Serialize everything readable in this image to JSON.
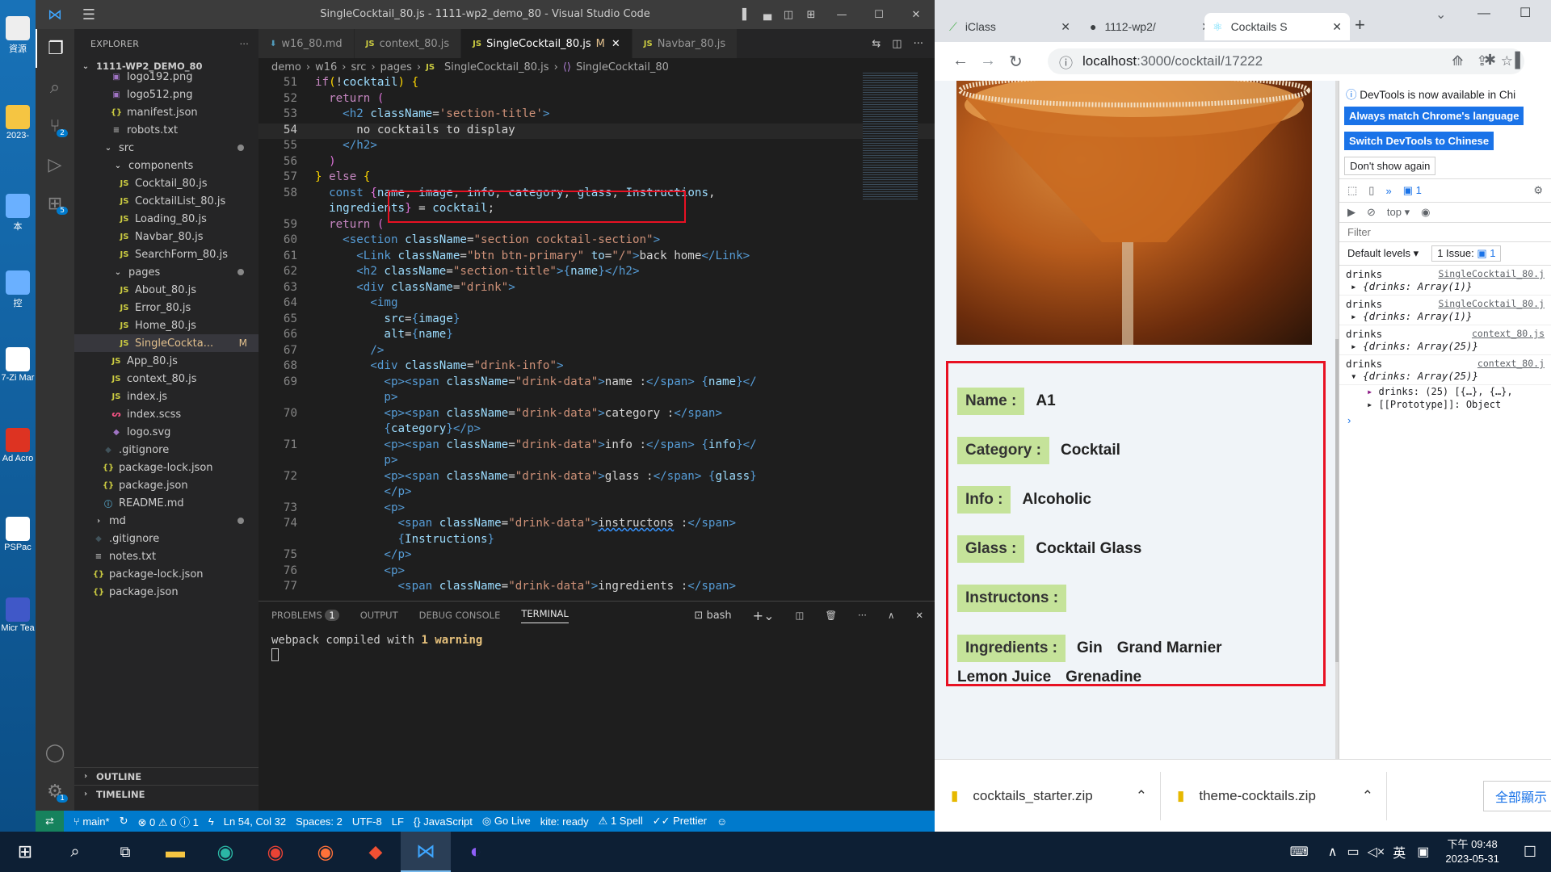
{
  "desktop": {
    "icons": [
      {
        "label": "資源"
      },
      {
        "label": "2023-"
      },
      {
        "label": "本"
      },
      {
        "label": "控"
      },
      {
        "label": "7-Zi Mar"
      },
      {
        "label": "Ad Acro"
      },
      {
        "label": "PSPac"
      },
      {
        "label": "Micr Tea"
      }
    ]
  },
  "vscode": {
    "title": "SingleCocktail_80.js - 1111-wp2_demo_80 - Visual Studio Code",
    "explorer_title": "EXPLORER",
    "project": "1111-WP2_DEMO_80",
    "activity_badges": {
      "scm": "2",
      "extensions": "5",
      "settings": "1"
    },
    "tree": [
      {
        "label": "logo192.png",
        "indent": 40,
        "icon": "image-icon",
        "color": "#a074c4"
      },
      {
        "label": "logo512.png",
        "indent": 40,
        "icon": "image-icon",
        "color": "#a074c4"
      },
      {
        "label": "manifest.json",
        "indent": 40,
        "icon": "json-icon",
        "color": "#cbcb41",
        "glyph": "{}"
      },
      {
        "label": "robots.txt",
        "indent": 40,
        "icon": "text-icon",
        "color": "#aaa",
        "glyph": "≡"
      },
      {
        "label": "src",
        "indent": 30,
        "icon": "chevron-down-icon",
        "color": "#ccc",
        "glyph": "⌄",
        "dot": true
      },
      {
        "label": "components",
        "indent": 42,
        "icon": "chevron-down-icon",
        "color": "#ccc",
        "glyph": "⌄"
      },
      {
        "label": "Cocktail_80.js",
        "indent": 50,
        "icon": "js-icon",
        "color": "#cbcb41",
        "glyph": "JS"
      },
      {
        "label": "CocktailList_80.js",
        "indent": 50,
        "icon": "js-icon",
        "color": "#cbcb41",
        "glyph": "JS"
      },
      {
        "label": "Loading_80.js",
        "indent": 50,
        "icon": "js-icon",
        "color": "#cbcb41",
        "glyph": "JS"
      },
      {
        "label": "Navbar_80.js",
        "indent": 50,
        "icon": "js-icon",
        "color": "#cbcb41",
        "glyph": "JS"
      },
      {
        "label": "SearchForm_80.js",
        "indent": 50,
        "icon": "js-icon",
        "color": "#cbcb41",
        "glyph": "JS"
      },
      {
        "label": "pages",
        "indent": 42,
        "icon": "chevron-down-icon",
        "color": "#ccc",
        "glyph": "⌄",
        "dot": true
      },
      {
        "label": "About_80.js",
        "indent": 50,
        "icon": "js-icon",
        "color": "#cbcb41",
        "glyph": "JS"
      },
      {
        "label": "Error_80.js",
        "indent": 50,
        "icon": "js-icon",
        "color": "#cbcb41",
        "glyph": "JS"
      },
      {
        "label": "Home_80.js",
        "indent": 50,
        "icon": "js-icon",
        "color": "#cbcb41",
        "glyph": "JS"
      },
      {
        "label": "SingleCockta...",
        "indent": 50,
        "icon": "js-icon",
        "color": "#cbcb41",
        "glyph": "JS",
        "status": "M",
        "selected": true
      },
      {
        "label": "App_80.js",
        "indent": 40,
        "icon": "js-icon",
        "color": "#cbcb41",
        "glyph": "JS"
      },
      {
        "label": "context_80.js",
        "indent": 40,
        "icon": "js-icon",
        "color": "#cbcb41",
        "glyph": "JS"
      },
      {
        "label": "index.js",
        "indent": 40,
        "icon": "js-icon",
        "color": "#cbcb41",
        "glyph": "JS"
      },
      {
        "label": "index.scss",
        "indent": 40,
        "icon": "scss-icon",
        "color": "#f55385",
        "glyph": "ᔕ"
      },
      {
        "label": "logo.svg",
        "indent": 40,
        "icon": "svg-icon",
        "color": "#a074c4",
        "glyph": "◆"
      },
      {
        "label": ".gitignore",
        "indent": 30,
        "icon": "git-icon",
        "color": "#41535b",
        "glyph": "◆"
      },
      {
        "label": "package-lock.json",
        "indent": 30,
        "icon": "json-icon",
        "color": "#cbcb41",
        "glyph": "{}"
      },
      {
        "label": "package.json",
        "indent": 30,
        "icon": "json-icon",
        "color": "#cbcb41",
        "glyph": "{}"
      },
      {
        "label": "README.md",
        "indent": 30,
        "icon": "info-icon",
        "color": "#519aba",
        "glyph": "ⓘ"
      },
      {
        "label": "md",
        "indent": 18,
        "icon": "chevron-right-icon",
        "color": "#ccc",
        "glyph": "›",
        "dot": true
      },
      {
        "label": ".gitignore",
        "indent": 18,
        "icon": "git-icon",
        "color": "#41535b",
        "glyph": "◆"
      },
      {
        "label": "notes.txt",
        "indent": 18,
        "icon": "text-icon",
        "color": "#aaa",
        "glyph": "≡"
      },
      {
        "label": "package-lock.json",
        "indent": 18,
        "icon": "json-icon",
        "color": "#cbcb41",
        "glyph": "{}"
      },
      {
        "label": "package.json",
        "indent": 18,
        "icon": "json-icon",
        "color": "#cbcb41",
        "glyph": "{}"
      }
    ],
    "outline": "OUTLINE",
    "timeline": "TIMELINE",
    "tabs": [
      {
        "label": "w16_80.md",
        "kind": "md"
      },
      {
        "label": "context_80.js",
        "kind": "js"
      },
      {
        "label": "SingleCocktail_80.js",
        "kind": "js",
        "status": "M",
        "active": true
      },
      {
        "label": "Navbar_80.js",
        "kind": "js"
      }
    ],
    "breadcrumb": [
      "demo",
      "w16",
      "src",
      "pages",
      "SingleCocktail_80.js",
      "SingleCocktail_80"
    ],
    "code_lines": [
      {
        "n": "51",
        "html": "<span class='k'>if</span><span class='y'>(</span><span class='tx'>!</span><span class='v'>cocktail</span><span class='y'>)</span><span class='tx'> </span><span class='y'>{</span>"
      },
      {
        "n": "52",
        "html": "  <span class='k'>return</span><span class='tx'> </span><span class='p'>(</span>"
      },
      {
        "n": "53",
        "html": "    <span class='tg'>&lt;h2</span> <span class='at'>className</span><span class='tx'>=</span><span class='s'>'section-title'</span><span class='tg'>&gt;</span>"
      },
      {
        "n": "54",
        "html": "      <span class='tx'>no cocktails to display</span>"
      },
      {
        "n": "55",
        "html": "    <span class='tg'>&lt;/h2&gt;</span>"
      },
      {
        "n": "56",
        "html": "  <span class='p'>)</span>"
      },
      {
        "n": "57",
        "html": "<span class='y'>}</span><span class='tx'> </span><span class='k'>else</span><span class='tx'> </span><span class='y'>{</span>"
      },
      {
        "n": "58",
        "html": "  <span class='b'>const</span><span class='tx'> </span><span class='p'>{</span><span class='v'>name</span><span class='tx'>, </span><span class='v'>image</span><span class='tx'>, </span><span class='v'>info</span><span class='tx'>, </span><span class='v'>category</span><span class='tx'>, </span><span class='v'>glass</span><span class='tx'>, </span><span class='v'>Instructions</span><span class='tx'>,</span>"
      },
      {
        "n": "",
        "html": "  <span class='v'>ingredients</span><span class='p'>}</span><span class='tx'> = </span><span class='v'>cocktail</span><span class='tx'>;</span>"
      },
      {
        "n": "59",
        "html": "  <span class='k'>return</span><span class='tx'> </span><span class='p'>(</span>"
      },
      {
        "n": "60",
        "html": "    <span class='tg'>&lt;section</span> <span class='at'>className</span><span class='tx'>=</span><span class='s'>\"section cocktail-section\"</span><span class='tg'>&gt;</span>"
      },
      {
        "n": "61",
        "html": "      <span class='tg'>&lt;Link</span> <span class='at'>className</span><span class='tx'>=</span><span class='s'>\"btn btn-primary\"</span> <span class='at'>to</span><span class='tx'>=</span><span class='s'>\"/\"</span><span class='tg'>&gt;</span><span class='tx'>back home</span><span class='tg'>&lt;/Link&gt;</span>"
      },
      {
        "n": "62",
        "html": "      <span class='tg'>&lt;h2</span> <span class='at'>className</span><span class='tx'>=</span><span class='s'>\"section-title\"</span><span class='tg'>&gt;</span><span class='b'>{</span><span class='v'>name</span><span class='b'>}</span><span class='tg'>&lt;/h2&gt;</span>"
      },
      {
        "n": "63",
        "html": "      <span class='tg'>&lt;div</span> <span class='at'>className</span><span class='tx'>=</span><span class='s'>\"drink\"</span><span class='tg'>&gt;</span>"
      },
      {
        "n": "64",
        "html": "        <span class='tg'>&lt;img</span>"
      },
      {
        "n": "65",
        "html": "          <span class='at'>src</span><span class='tx'>=</span><span class='b'>{</span><span class='v'>image</span><span class='b'>}</span>"
      },
      {
        "n": "66",
        "html": "          <span class='at'>alt</span><span class='tx'>=</span><span class='b'>{</span><span class='v'>name</span><span class='b'>}</span>"
      },
      {
        "n": "67",
        "html": "        <span class='tg'>/&gt;</span>"
      },
      {
        "n": "68",
        "html": "        <span class='tg'>&lt;div</span> <span class='at'>className</span><span class='tx'>=</span><span class='s'>\"drink-info\"</span><span class='tg'>&gt;</span>"
      },
      {
        "n": "69",
        "html": "          <span class='tg'>&lt;p&gt;&lt;span</span> <span class='at'>className</span><span class='tx'>=</span><span class='s'>\"drink-data\"</span><span class='tg'>&gt;</span><span class='tx'>name :</span><span class='tg'>&lt;/span&gt;</span> <span class='b'>{</span><span class='v'>name</span><span class='b'>}</span><span class='tg'>&lt;/</span>"
      },
      {
        "n": "",
        "html": "          <span class='tg'>p&gt;</span>"
      },
      {
        "n": "70",
        "html": "          <span class='tg'>&lt;p&gt;&lt;span</span> <span class='at'>className</span><span class='tx'>=</span><span class='s'>\"drink-data\"</span><span class='tg'>&gt;</span><span class='tx'>category :</span><span class='tg'>&lt;/span&gt;</span>"
      },
      {
        "n": "",
        "html": "          <span class='b'>{</span><span class='v'>category</span><span class='b'>}</span><span class='tg'>&lt;/p&gt;</span>"
      },
      {
        "n": "71",
        "html": "          <span class='tg'>&lt;p&gt;&lt;span</span> <span class='at'>className</span><span class='tx'>=</span><span class='s'>\"drink-data\"</span><span class='tg'>&gt;</span><span class='tx'>info :</span><span class='tg'>&lt;/span&gt;</span> <span class='b'>{</span><span class='v'>info</span><span class='b'>}</span><span class='tg'>&lt;/</span>"
      },
      {
        "n": "",
        "html": "          <span class='tg'>p&gt;</span>"
      },
      {
        "n": "72",
        "html": "          <span class='tg'>&lt;p&gt;&lt;span</span> <span class='at'>className</span><span class='tx'>=</span><span class='s'>\"drink-data\"</span><span class='tg'>&gt;</span><span class='tx'>glass :</span><span class='tg'>&lt;/span&gt;</span> <span class='b'>{</span><span class='v'>glass</span><span class='b'>}</span>"
      },
      {
        "n": "",
        "html": "          <span class='tg'>&lt;/p&gt;</span>"
      },
      {
        "n": "73",
        "html": "          <span class='tg'>&lt;p&gt;</span>"
      },
      {
        "n": "74",
        "html": "            <span class='tg'>&lt;span</span> <span class='at'>className</span><span class='tx'>=</span><span class='s'>\"drink-data\"</span><span class='tg'>&gt;</span><span class='tx' style='text-decoration:underline wavy #3794ff'>instructons</span><span class='tx'> :</span><span class='tg'>&lt;/span&gt;</span>"
      },
      {
        "n": "",
        "html": "            <span class='b'>{</span><span class='v'>Instructions</span><span class='b'>}</span>"
      },
      {
        "n": "75",
        "html": "          <span class='tg'>&lt;/p&gt;</span>"
      },
      {
        "n": "76",
        "html": "          <span class='tg'>&lt;p&gt;</span>"
      },
      {
        "n": "77",
        "html": "            <span class='tg'>&lt;span</span> <span class='at'>className</span><span class='tx'>=</span><span class='s'>\"drink-data\"</span><span class='tg'>&gt;</span><span class='tx'>ingredients :</span><span class='tg'>&lt;/span&gt;</span>"
      }
    ],
    "panel_tabs": {
      "problems": "PROBLEMS",
      "problems_count": "1",
      "output": "OUTPUT",
      "debug": "DEBUG CONSOLE",
      "terminal": "TERMINAL",
      "shell": "bash"
    },
    "terminal_text": "webpack compiled with ",
    "terminal_warn": "1 warning",
    "status": {
      "branch": "main*",
      "errors": "0",
      "warnings": "0",
      "info": "1",
      "position": "Ln 54, Col 32",
      "spaces": "Spaces: 2",
      "encoding": "UTF-8",
      "eol": "LF",
      "language": "JavaScript",
      "golive": "Go Live",
      "kite": "kite: ready",
      "spell": "1 Spell",
      "prettier": "Prettier"
    }
  },
  "chrome": {
    "tabs": [
      {
        "label": "iClass"
      },
      {
        "label": "1112-wp2/"
      },
      {
        "label": "Cocktails S"
      }
    ],
    "url_host": "localhost",
    "url_path": ":3000/cocktail/17222",
    "drink": {
      "name_label": "Name :",
      "name": "A1",
      "category_label": "Category :",
      "category": "Cocktail",
      "info_label": "Info :",
      "info": "Alcoholic",
      "glass_label": "Glass :",
      "glass": "Cocktail Glass",
      "instructions_label": "Instructons :",
      "ingredients_label": "Ingredients :",
      "ingredients": [
        "Gin",
        "Grand Marnier",
        "Lemon Juice",
        "Grenadine"
      ]
    },
    "devtools": {
      "notice": "DevTools is now available in Chi",
      "btn1": "Always match Chrome's language",
      "btn2": "Switch DevTools to Chinese",
      "btn3": "Don't show again",
      "msg_count": "1",
      "context": "top",
      "filter_placeholder": "Filter",
      "levels": "Default levels",
      "issues": "1 Issue:",
      "issues_count": "1",
      "logs": [
        {
          "label": "drinks",
          "src": "SingleCocktail_80.j",
          "obj": "{drinks: Array(1)}"
        },
        {
          "label": "drinks",
          "src": "SingleCocktail_80.j",
          "obj": "{drinks: Array(1)}"
        },
        {
          "label": "drinks",
          "src": "context_80.js",
          "obj": "{drinks: Array(25)}"
        },
        {
          "label": "drinks",
          "src": "context_80.j",
          "obj": "{drinks: Array(25)}"
        }
      ],
      "expanded1": "drinks: (25) [{…}, {…},",
      "expanded2": "[[Prototype]]: Object"
    },
    "downloads": [
      {
        "label": "cocktails_starter.zip"
      },
      {
        "label": "theme-cocktails.zip"
      }
    ],
    "show_all": "全部顯示"
  },
  "taskbar": {
    "time": "下午 09:48",
    "date": "2023-05-31",
    "ime": "英"
  }
}
